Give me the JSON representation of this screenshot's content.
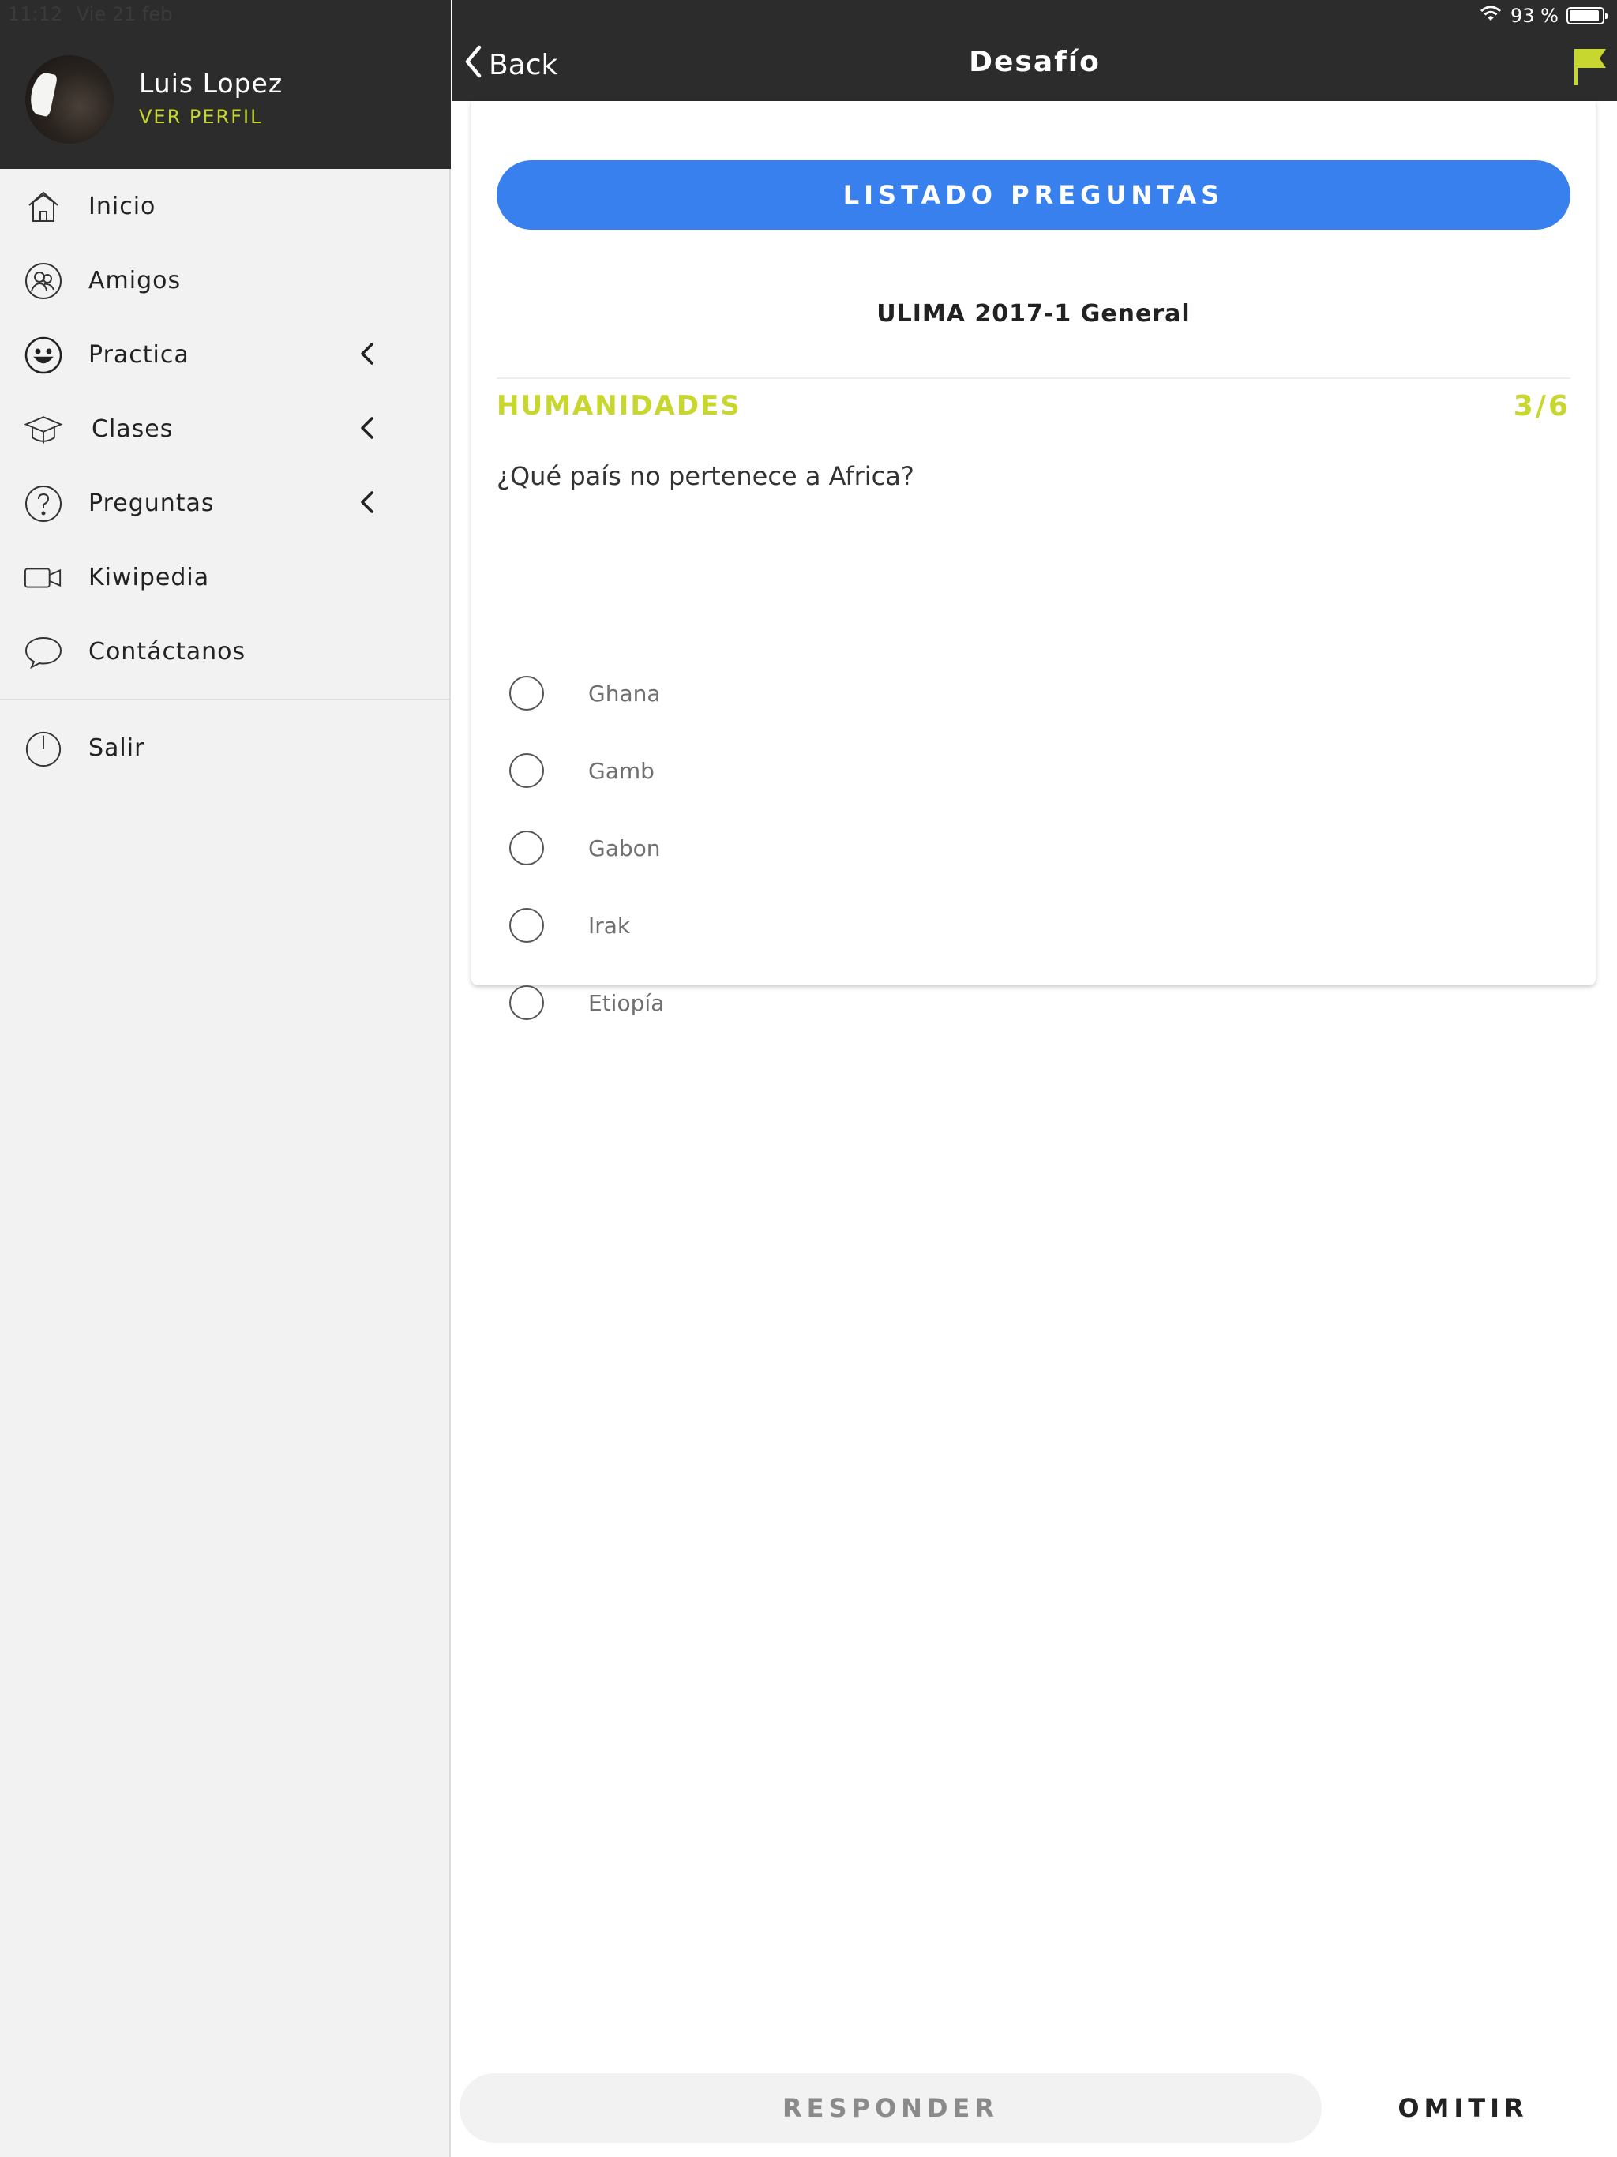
{
  "status_bar": {
    "time": "11:12",
    "date": "Vie 21 feb",
    "battery": "93 %",
    "battery_level": 0.93
  },
  "profile": {
    "name": "Luis Lopez",
    "link": "VER PERFIL"
  },
  "sidebar": {
    "items": [
      {
        "label": "Inicio",
        "icon": "home-icon",
        "has_chevron": false
      },
      {
        "label": "Amigos",
        "icon": "friends-icon",
        "has_chevron": false
      },
      {
        "label": "Practica",
        "icon": "smiley-icon",
        "has_chevron": true
      },
      {
        "label": "Clases",
        "icon": "graduation-cap-icon",
        "has_chevron": true
      },
      {
        "label": "Preguntas",
        "icon": "question-icon",
        "has_chevron": true
      },
      {
        "label": "Kiwipedia",
        "icon": "video-camera-icon",
        "has_chevron": false
      },
      {
        "label": "Contáctanos",
        "icon": "chat-bubble-icon",
        "has_chevron": false
      }
    ],
    "exit_label": "Salir"
  },
  "header": {
    "back_label": "Back",
    "title": "Desafío",
    "flag_color": "#c8d72f"
  },
  "quiz": {
    "list_button": "LISTADO PREGUNTAS",
    "exam_title": "ULIMA 2017-1 General",
    "category": "HUMANIDADES",
    "counter": "3/6",
    "question": "¿Qué país no pertenece a Africa?",
    "options": [
      "Ghana",
      "Gamb",
      "Gabon",
      "Irak",
      "Etiopía"
    ]
  },
  "footer": {
    "respond_label": "RESPONDER",
    "omit_label": "OMITIR"
  },
  "colors": {
    "accent_yellow": "#c8d72f",
    "primary_blue": "#3880ee",
    "dark_bar": "#2c2c2c"
  }
}
